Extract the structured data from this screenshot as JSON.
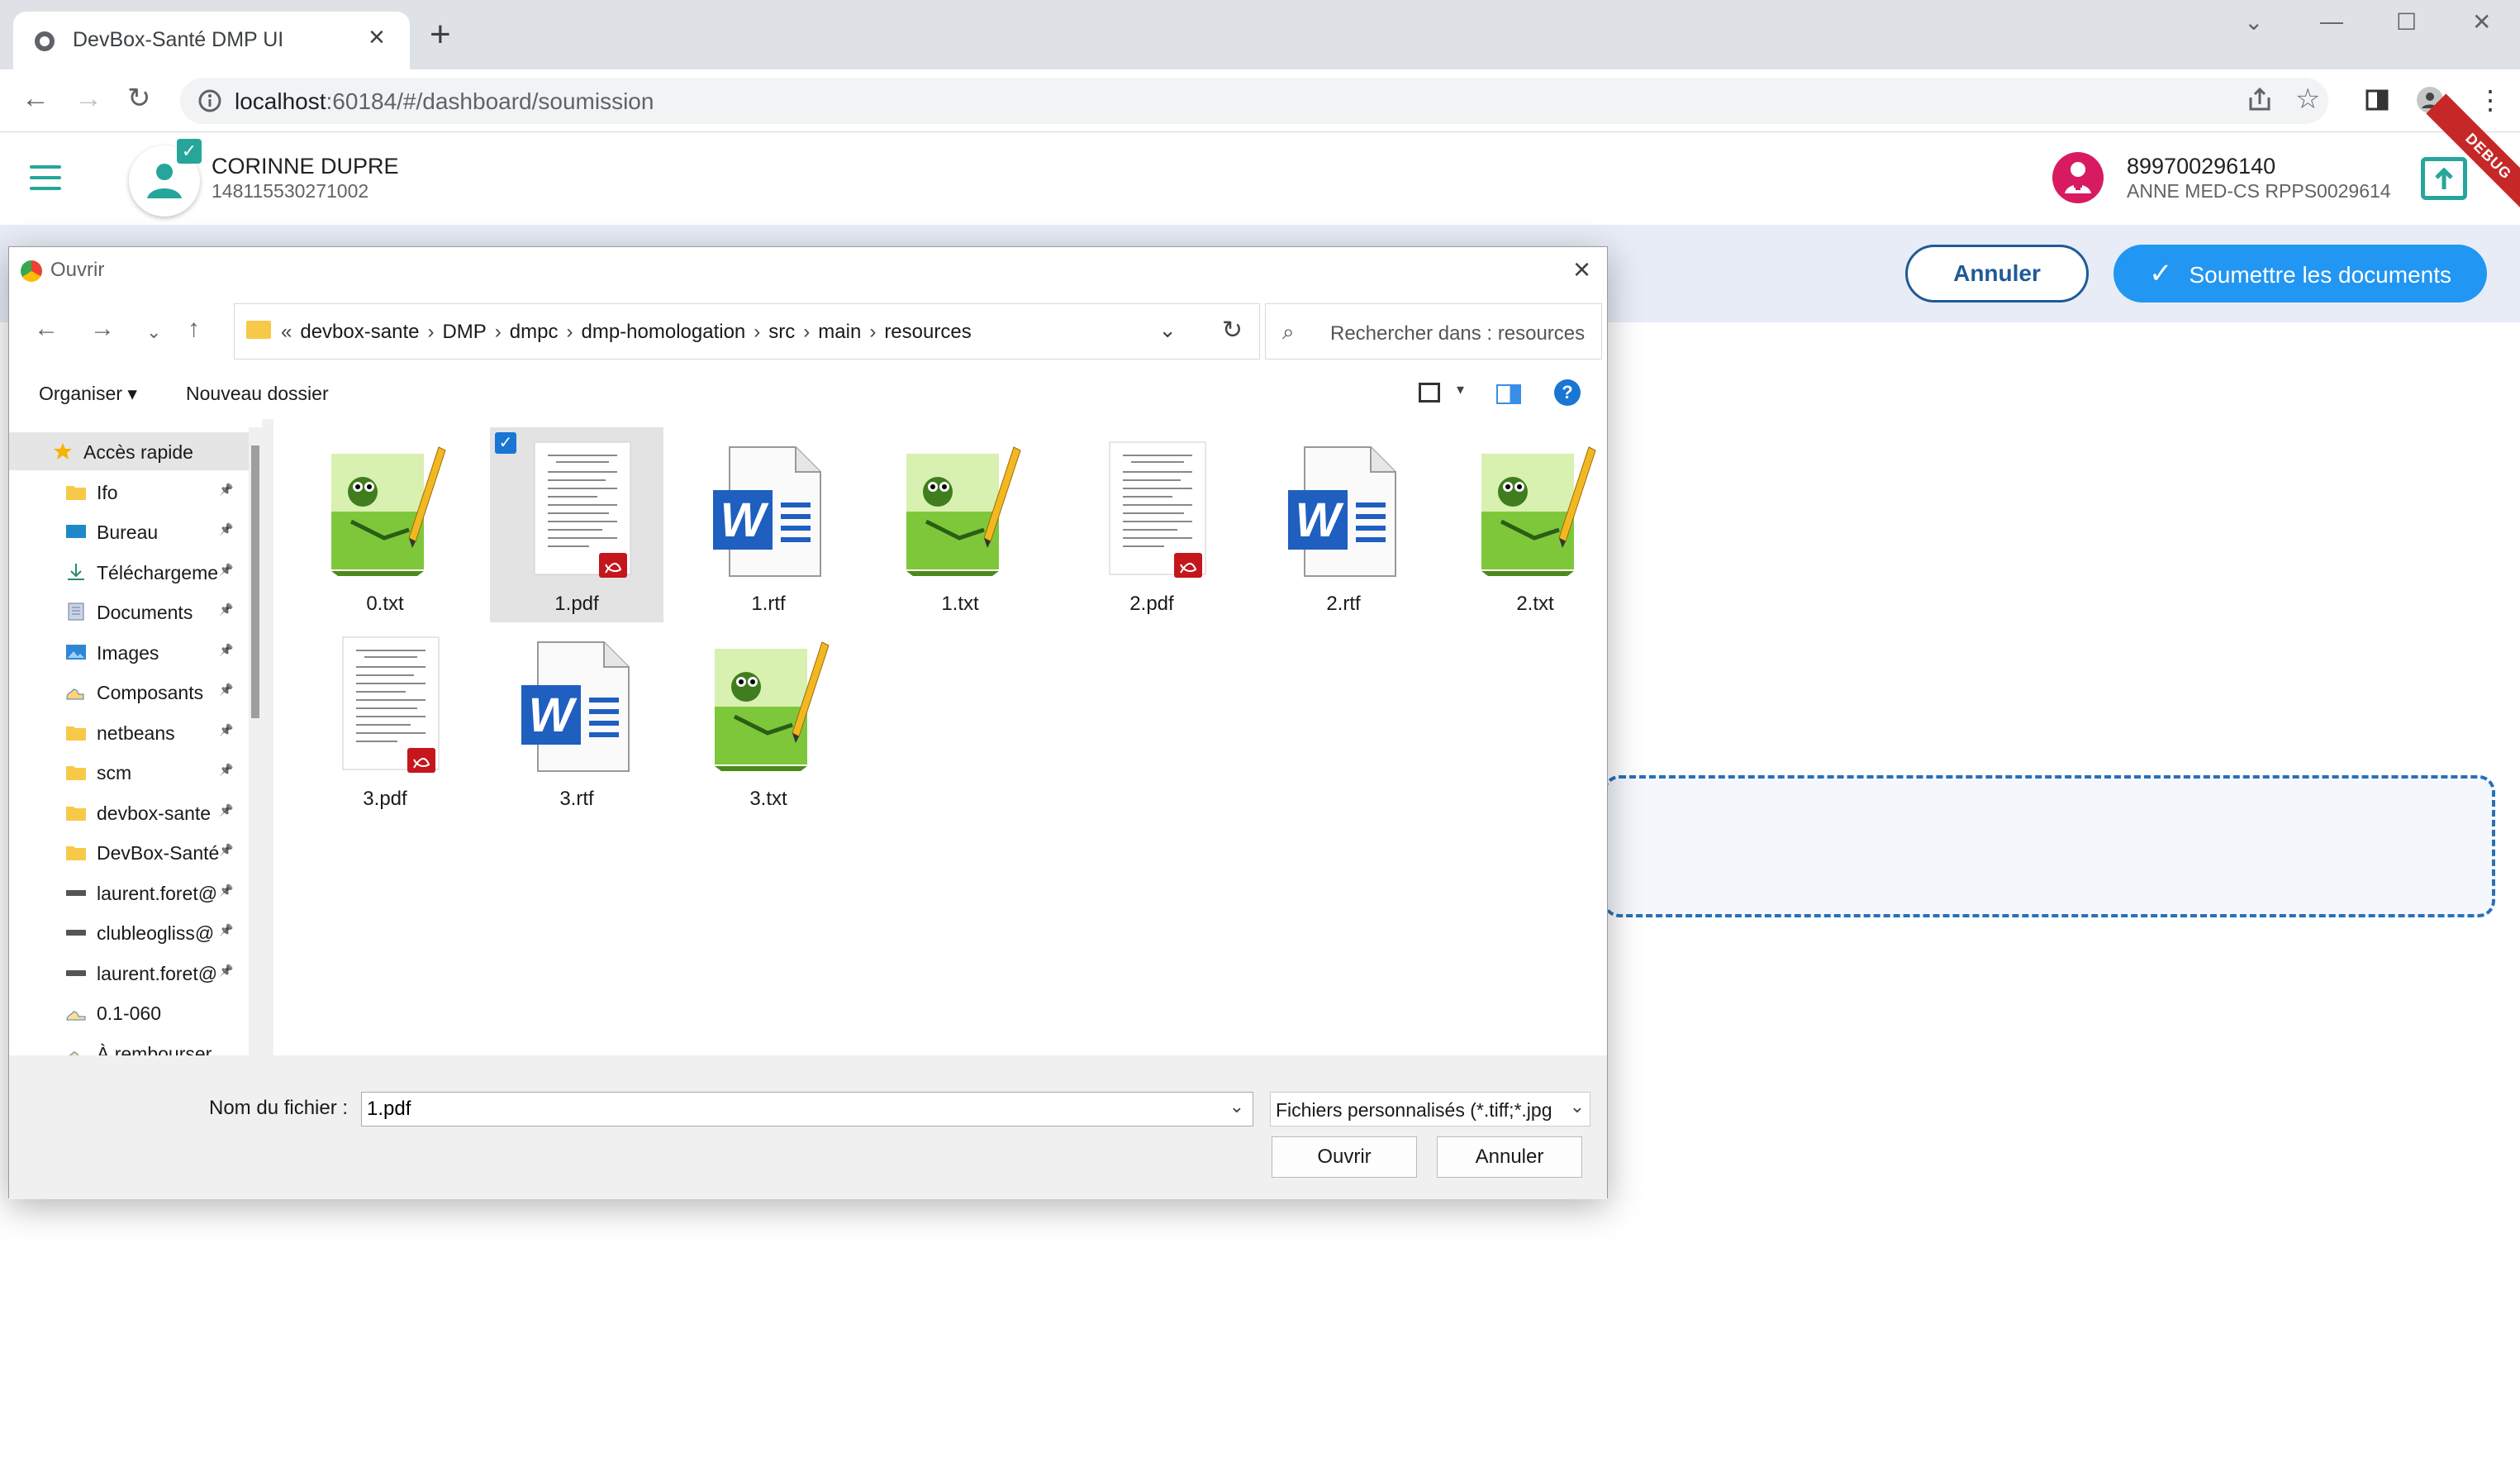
{
  "browser": {
    "tab_title": "DevBox-Santé DMP UI",
    "url_host": "localhost",
    "url_path": ":60184/#/dashboard/soumission"
  },
  "header": {
    "patient_name": "CORINNE DUPRE",
    "patient_id": "148115530271002",
    "ps_id": "899700296140",
    "ps_name": "ANNE MED-CS RPPS0029614",
    "debug_ribbon": "DEBUG"
  },
  "page": {
    "cancel_label": "Annuler",
    "submit_label": "Soumettre les documents"
  },
  "dialog": {
    "title": "Ouvrir",
    "breadcrumb": [
      "devbox-sante",
      "DMP",
      "dmpc",
      "dmp-homologation",
      "src",
      "main",
      "resources"
    ],
    "search_placeholder": "Rechercher dans : resources",
    "organize_label": "Organiser ▾",
    "new_folder_label": "Nouveau dossier",
    "sidebar": [
      {
        "label": "Accès rapide",
        "icon": "star-icon",
        "pinned": false
      },
      {
        "label": "Ifo",
        "icon": "folder-icon",
        "pinned": true
      },
      {
        "label": "Bureau",
        "icon": "desktop-icon",
        "pinned": true
      },
      {
        "label": "Téléchargements",
        "icon": "download-icon",
        "pinned": true
      },
      {
        "label": "Documents",
        "icon": "documents-icon",
        "pinned": true
      },
      {
        "label": "Images",
        "icon": "images-icon",
        "pinned": true
      },
      {
        "label": "Composants",
        "icon": "components-icon",
        "pinned": true
      },
      {
        "label": "netbeans",
        "icon": "folder-icon",
        "pinned": true
      },
      {
        "label": "scm",
        "icon": "folder-icon",
        "pinned": true
      },
      {
        "label": "devbox-sante",
        "icon": "folder-icon",
        "pinned": true
      },
      {
        "label": "DevBox-Santé",
        "icon": "folder-icon",
        "pinned": true
      },
      {
        "label": "laurent.foret@",
        "icon": "drive-icon",
        "pinned": true
      },
      {
        "label": "clubleogliss@",
        "icon": "drive-icon",
        "pinned": true
      },
      {
        "label": "laurent.foret@",
        "icon": "drive-icon",
        "pinned": true
      },
      {
        "label": "0.1-060",
        "icon": "cloud-folder-icon",
        "pinned": false
      },
      {
        "label": "À rembourser",
        "icon": "cloud-folder-icon",
        "pinned": false
      }
    ],
    "files": [
      {
        "name": "0.txt",
        "type": "txt",
        "selected": false
      },
      {
        "name": "1.pdf",
        "type": "pdf",
        "selected": true
      },
      {
        "name": "1.rtf",
        "type": "rtf",
        "selected": false
      },
      {
        "name": "1.txt",
        "type": "txt",
        "selected": false
      },
      {
        "name": "2.pdf",
        "type": "pdf",
        "selected": false
      },
      {
        "name": "2.rtf",
        "type": "rtf",
        "selected": false
      },
      {
        "name": "2.txt",
        "type": "txt",
        "selected": false
      },
      {
        "name": "3.pdf",
        "type": "pdf",
        "selected": false
      },
      {
        "name": "3.rtf",
        "type": "rtf",
        "selected": false
      },
      {
        "name": "3.txt",
        "type": "txt",
        "selected": false
      }
    ],
    "filename_label": "Nom du fichier :",
    "filename_value": "1.pdf",
    "filetype_value": "Fichiers personnalisés (*.tiff;*.jpg",
    "open_label": "Ouvrir",
    "cancel_label": "Annuler"
  },
  "colors": {
    "accent": "#2196f3",
    "teal": "#26a69a",
    "ps_badge": "#d81b60",
    "debug": "#c62828"
  }
}
